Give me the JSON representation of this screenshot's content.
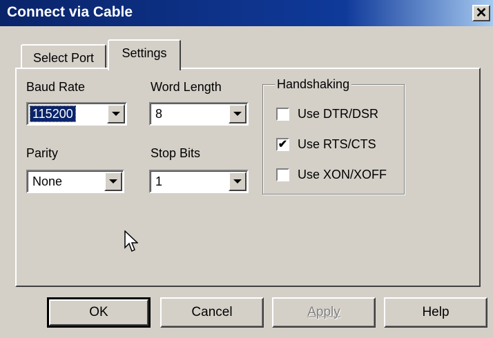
{
  "window": {
    "title": "Connect via Cable",
    "close_glyph": "✕"
  },
  "tabs": [
    {
      "label": "Select Port",
      "active": false
    },
    {
      "label": "Settings",
      "active": true
    }
  ],
  "settings": {
    "baud_rate": {
      "label": "Baud Rate",
      "value": "115200"
    },
    "word_length": {
      "label": "Word Length",
      "value": "8"
    },
    "parity": {
      "label": "Parity",
      "value": "None"
    },
    "stop_bits": {
      "label": "Stop Bits",
      "value": "1"
    }
  },
  "handshaking": {
    "legend": "Handshaking",
    "options": [
      {
        "label": "Use DTR/DSR",
        "checked": false
      },
      {
        "label": "Use RTS/CTS",
        "checked": true
      },
      {
        "label": "Use XON/XOFF",
        "checked": false
      }
    ]
  },
  "buttons": {
    "ok": "OK",
    "cancel": "Cancel",
    "apply": "Apply",
    "help": "Help"
  },
  "icons": {
    "close": "close-icon",
    "dropdown": "chevron-down-icon",
    "check": "check-icon",
    "cursor": "mouse-pointer-icon"
  },
  "colors": {
    "titlebar": "#0a246a",
    "face": "#d4d0c8",
    "selection": "#0a246a",
    "disabled_text": "#808080"
  }
}
